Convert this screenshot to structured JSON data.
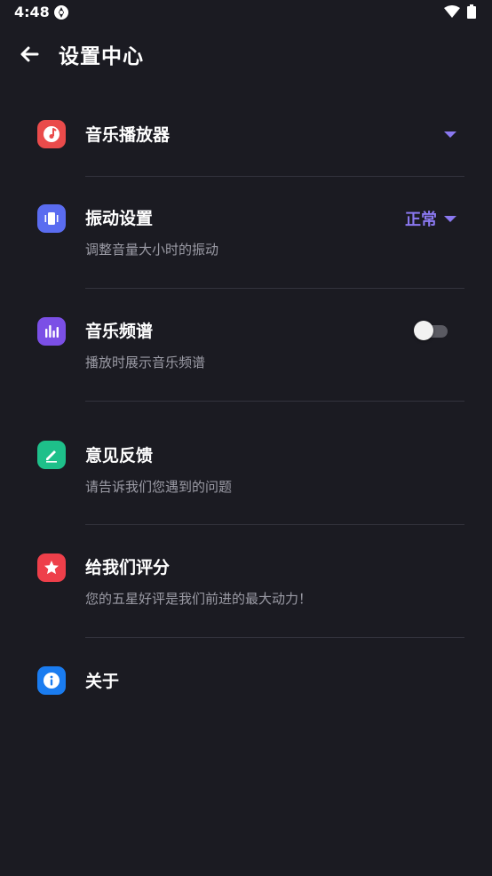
{
  "status_bar": {
    "time": "4:48"
  },
  "header": {
    "title": "设置中心"
  },
  "colors": {
    "background": "#1b1b22",
    "accent": "#8a78f0",
    "music_player_icon": "#ea4b4b",
    "vibration_icon": "#5a6cf0",
    "spectrum_icon": "#7b4fe6",
    "feedback_icon": "#1ec08a",
    "rate_icon": "#ee3f4a",
    "about_icon": "#1a7cf0"
  },
  "settings": {
    "music_player": {
      "title": "音乐播放器",
      "icon": "music-note-icon"
    },
    "vibration": {
      "title": "振动设置",
      "subtitle": "调整音量大小时的振动",
      "value": "正常",
      "icon": "vibration-icon"
    },
    "spectrum": {
      "title": "音乐频谱",
      "subtitle": "播放时展示音乐频谱",
      "enabled": false,
      "icon": "equalizer-icon"
    },
    "feedback": {
      "title": "意见反馈",
      "subtitle": "请告诉我们您遇到的问题",
      "icon": "edit-icon"
    },
    "rate": {
      "title": "给我们评分",
      "subtitle": "您的五星好评是我们前进的最大动力！",
      "icon": "star-icon"
    },
    "about": {
      "title": "关于",
      "icon": "info-icon"
    }
  }
}
